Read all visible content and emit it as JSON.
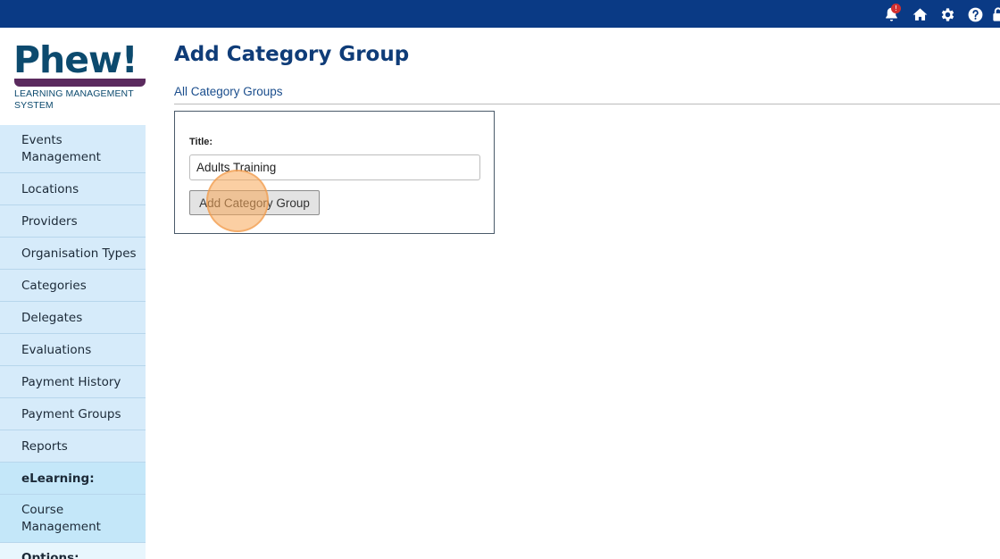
{
  "topbar": {
    "color": "#0a3a85",
    "notification_badge": "!",
    "icons": [
      "bell-icon",
      "home-icon",
      "gear-icon",
      "help-icon",
      "lock-icon"
    ]
  },
  "logo": {
    "word": "Phew!",
    "subtitle_line1": "LEARNING MANAGEMENT",
    "subtitle_line2": "SYSTEM",
    "brand_color": "#0c4a6e",
    "bar_color": "#5b2a5e"
  },
  "sidebar": {
    "items": [
      {
        "line1": "Events",
        "line2": "Management"
      },
      {
        "label": "Locations"
      },
      {
        "label": "Providers"
      },
      {
        "label": "Organisation Types"
      },
      {
        "label": "Categories"
      },
      {
        "label": "Delegates"
      },
      {
        "label": "Evaluations"
      },
      {
        "label": "Payment History"
      },
      {
        "label": "Payment Groups"
      },
      {
        "label": "Reports"
      },
      {
        "label": "eLearning:"
      },
      {
        "line1": "Course",
        "line2": "Management"
      },
      {
        "label": "Options:"
      }
    ]
  },
  "main": {
    "title": "Add Category Group",
    "breadcrumb_link": "All Category Groups",
    "form": {
      "title_label": "Title:",
      "title_value": "Adults Training",
      "submit_label": "Add Category Group"
    }
  }
}
